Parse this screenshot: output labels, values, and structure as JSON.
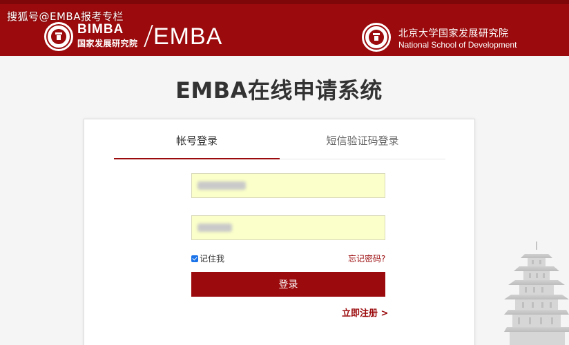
{
  "watermark": "搜狐号@EMBA报考专栏",
  "header": {
    "bimba_logo_text": "BIMBA",
    "bimba_logo_sub": "国家发展研究院",
    "emba_wordmark": "EMBA",
    "school_name_cn": "北京大学国家发展研究院",
    "school_name_en": "National School of Development"
  },
  "page_title": "EMBA在线申请系统",
  "tabs": [
    {
      "label": "帐号登录",
      "active": true
    },
    {
      "label": "短信验证码登录",
      "active": false
    }
  ],
  "form": {
    "remember_label": "记住我",
    "remember_checked": true,
    "forgot_link": "忘记密码?",
    "login_button": "登录",
    "register_link": "立即注册 >"
  },
  "colors": {
    "brand_red": "#9b0a0c",
    "autofill_yellow": "#fbffc9"
  }
}
